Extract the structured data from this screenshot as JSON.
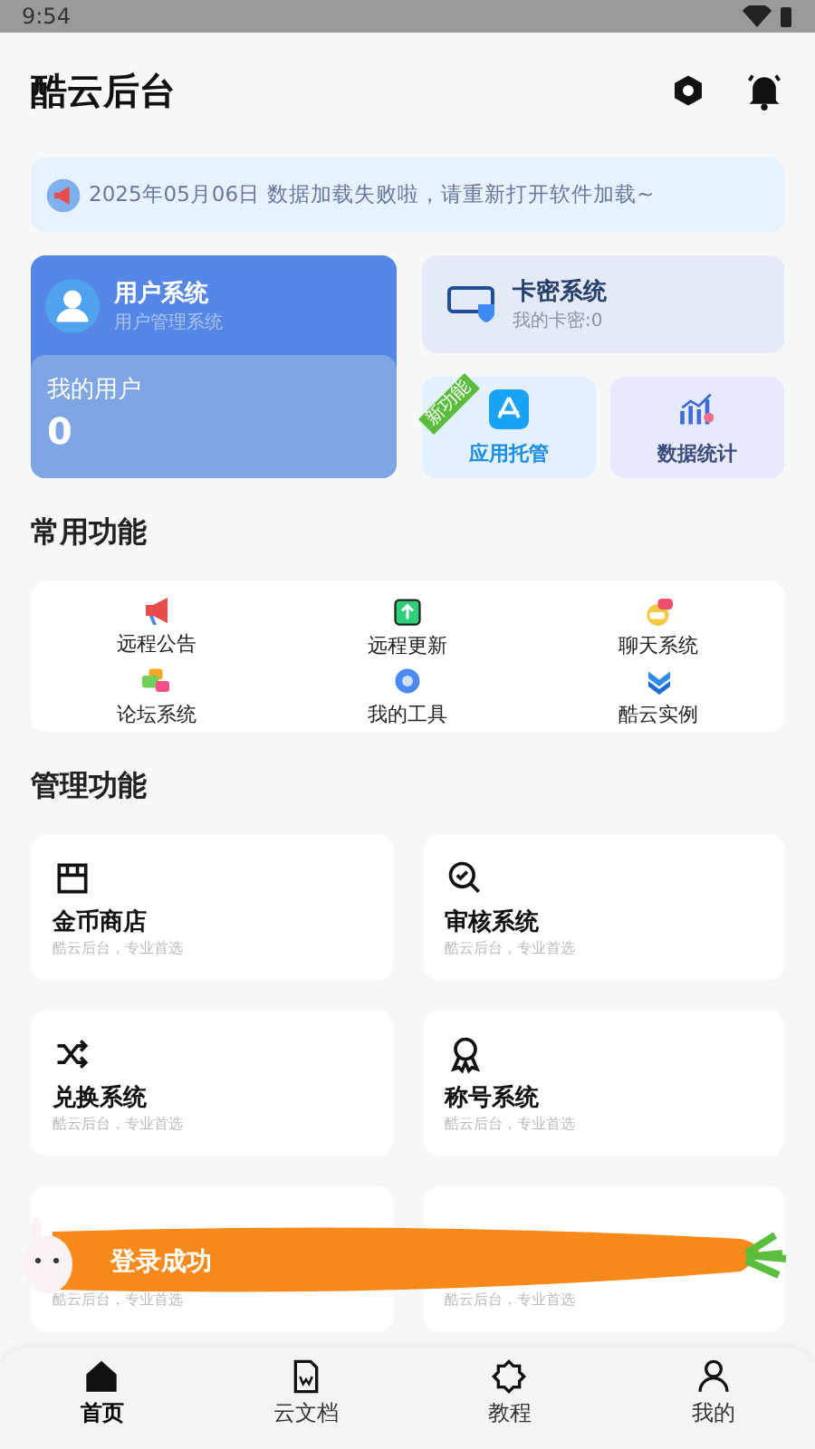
{
  "status_bar": {
    "time": "9:54"
  },
  "header": {
    "title": "酷云后台"
  },
  "notice": {
    "date": "2025年05月06日",
    "text": "数据加载失败啦，请重新打开软件加载~"
  },
  "user_card": {
    "title": "用户系统",
    "subtitle": "用户管理系统",
    "label": "我的用户",
    "count": "0"
  },
  "card_card": {
    "title": "卡密系统",
    "subtitle": "我的卡密:0"
  },
  "tiles": [
    {
      "label": "应用托管",
      "badge": "新功能",
      "kind": "apps"
    },
    {
      "label": "数据统计",
      "kind": "stats"
    }
  ],
  "common": {
    "title": "常用功能",
    "items": [
      {
        "label": "远程公告",
        "kind": "megaphone"
      },
      {
        "label": "远程更新",
        "kind": "update"
      },
      {
        "label": "聊天系统",
        "kind": "chat"
      },
      {
        "label": "论坛系统",
        "kind": "forum"
      },
      {
        "label": "我的工具",
        "kind": "tool"
      },
      {
        "label": "酷云实例",
        "kind": "chevrons"
      }
    ]
  },
  "manage": {
    "title": "管理功能",
    "items": [
      {
        "title": "金币商店",
        "subtitle": "酷云后台，专业首选",
        "kind": "shop"
      },
      {
        "title": "审核系统",
        "subtitle": "酷云后台，专业首选",
        "kind": "review"
      },
      {
        "title": "兑换系统",
        "subtitle": "酷云后台，专业首选",
        "kind": "shuffle"
      },
      {
        "title": "称号系统",
        "subtitle": "酷云后台，专业首选",
        "kind": "medal"
      },
      {
        "subtitle": "酷云后台，专业首选",
        "kind": "none"
      },
      {
        "subtitle": "酷云后台，专业首选",
        "kind": "none"
      }
    ]
  },
  "toast": {
    "text": "登录成功"
  },
  "nav": [
    {
      "label": "首页",
      "kind": "home",
      "selected": true
    },
    {
      "label": "云文档",
      "kind": "doc",
      "selected": false
    },
    {
      "label": "教程",
      "kind": "gear",
      "selected": false
    },
    {
      "label": "我的",
      "kind": "user",
      "selected": false
    }
  ]
}
